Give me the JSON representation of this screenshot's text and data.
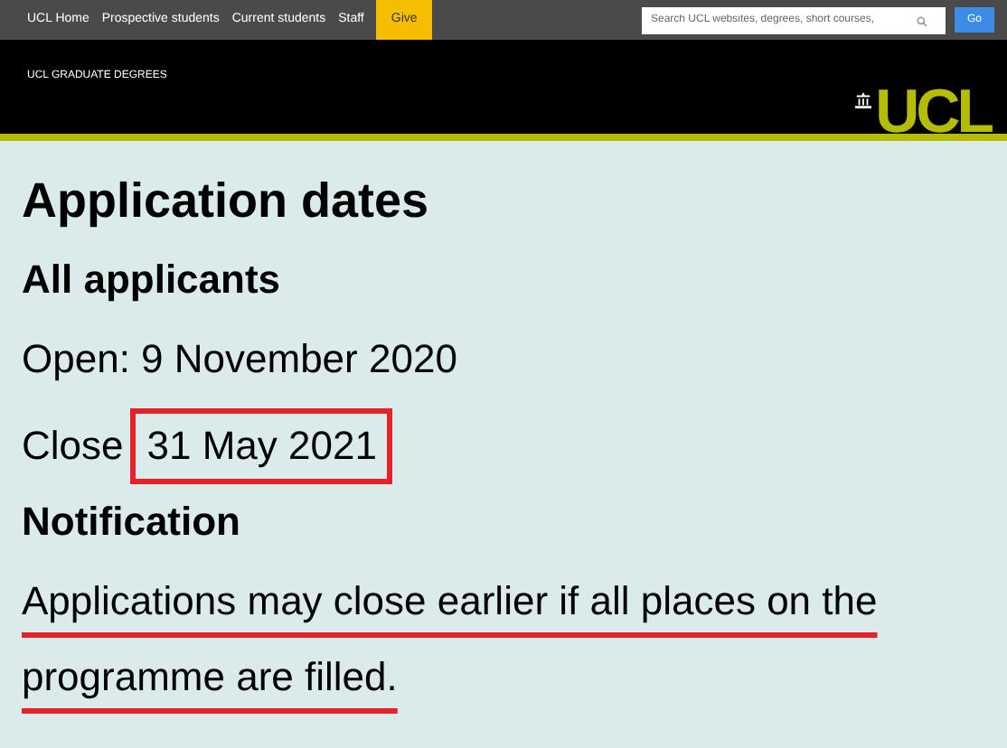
{
  "top_nav": {
    "links": [
      "UCL Home",
      "Prospective students",
      "Current students",
      "Staff"
    ],
    "give_button": "Give",
    "search": {
      "placeholder": "Search UCL websites, degrees, short courses,"
    },
    "go_button": "Go"
  },
  "header": {
    "section_title": "UCL GRADUATE DEGREES",
    "logo_text": "UCL"
  },
  "content": {
    "title": "Application dates",
    "subtitle": "All applicants",
    "open_line": "Open: 9 November 2020",
    "close_label": "Close",
    "close_date": {
      "text": "31 May 2021",
      "highlighted": true
    },
    "notification_heading": "Notification",
    "notification": {
      "text": "Applications may close earlier if all places on the programme are filled.",
      "underlined": true
    }
  }
}
